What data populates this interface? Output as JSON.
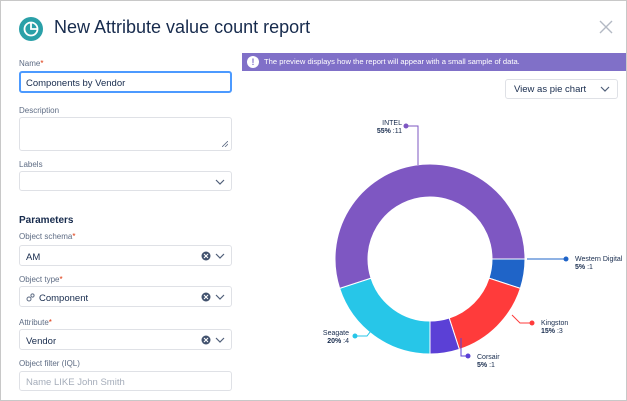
{
  "header": {
    "title": "New Attribute value count report"
  },
  "form": {
    "name_label": "Name",
    "name_value": "Components by Vendor",
    "description_label": "Description",
    "labels_label": "Labels",
    "parameters_heading": "Parameters",
    "object_schema_label": "Object schema",
    "object_schema_value": "AM",
    "object_type_label": "Object type",
    "object_type_value": "Component",
    "attribute_label": "Attribute",
    "attribute_value": "Vendor",
    "object_filter_label": "Object filter (IQL)",
    "object_filter_placeholder": "Name LIKE John Smith",
    "required_mark": "*"
  },
  "preview": {
    "banner_text": "The preview displays how the report will appear with a small sample of data.",
    "banner_icon": "!",
    "view_select_value": "View as pie chart"
  },
  "colors": {
    "accent": "#8070c8",
    "focus": "#4c9aff"
  },
  "chart_data": {
    "type": "pie",
    "donut": true,
    "slices": [
      {
        "name": "Western Digital",
        "percent": "5%",
        "count": 1,
        "color": "#1f64c8"
      },
      {
        "name": "Kingston",
        "percent": "15%",
        "count": 3,
        "color": "#ff3b3b"
      },
      {
        "name": "Corsair",
        "percent": "5%",
        "count": 1,
        "color": "#5b40d6"
      },
      {
        "name": "Seagate",
        "percent": "20%",
        "count": 4,
        "color": "#27c6e8"
      },
      {
        "name": "INTEL",
        "percent": "55%",
        "count": 11,
        "color": "#7e57c2"
      }
    ]
  }
}
